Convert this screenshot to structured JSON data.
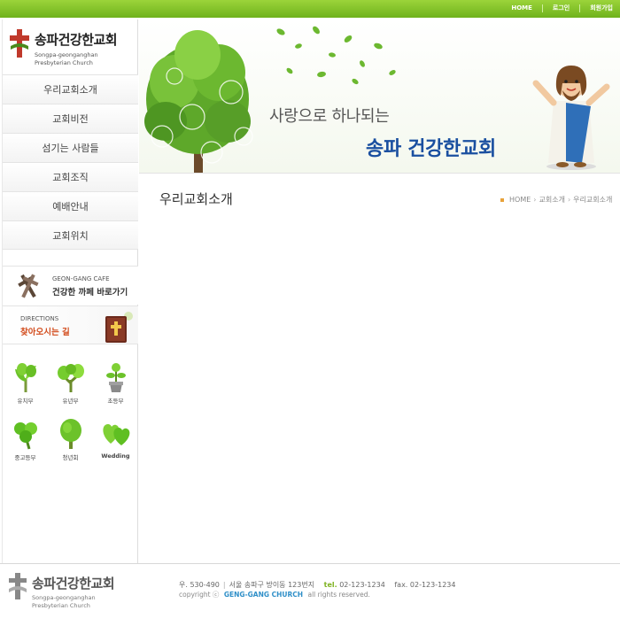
{
  "topnav": {
    "home": "HOME",
    "login": "로그인",
    "join": "회원가입"
  },
  "logo": {
    "name": "송파건강한교회",
    "sub1": "Songpa-geonganghan",
    "sub2": "Presbyterian Church"
  },
  "menu": {
    "items": [
      {
        "label": "우리교회소개"
      },
      {
        "label": "교회비전"
      },
      {
        "label": "섬기는 사람들"
      },
      {
        "label": "교회조직"
      },
      {
        "label": "예배안내"
      },
      {
        "label": "교회위치"
      }
    ]
  },
  "banners": {
    "cafe": {
      "sub": "GEON-GANG CAFE",
      "main": "건강한 까페 바로가기"
    },
    "directions": {
      "sub": "DIRECTIONS",
      "main": "찾아오시는 길"
    }
  },
  "departments": [
    {
      "label": "유치부",
      "icon": "sprout-icon"
    },
    {
      "label": "유년부",
      "icon": "tree-icon"
    },
    {
      "label": "초등부",
      "icon": "potted-plant-icon"
    },
    {
      "label": "중고등부",
      "icon": "clover-icon"
    },
    {
      "label": "청년회",
      "icon": "tree-icon"
    },
    {
      "label": "Wedding",
      "icon": "hearts-icon"
    }
  ],
  "hero": {
    "line1": "사랑으로 하나되는",
    "line2": "송파 건강한교회"
  },
  "page": {
    "title": "우리교회소개",
    "breadcrumb": [
      "HOME",
      "교회소개",
      "우리교회소개"
    ]
  },
  "footer": {
    "logo_name": "송파건강한교회",
    "logo_sub1": "Songpa-geonganghan",
    "logo_sub2": "Presbyterian Church",
    "address": "우. 530-490",
    "address2": "서울 송파구 방이동 123번지",
    "tel_label": "tel.",
    "tel": "02-123-1234",
    "fax_label": "fax.",
    "fax": "02-123-1234",
    "copy_prefix": "copyright ⓒ",
    "church": "GENG-GANG CHURCH",
    "copy_suffix": "all rights reserved."
  },
  "colors": {
    "accent_green": "#7fb322",
    "brand_blue": "#1a4fa0",
    "cross_red": "#c0392b"
  }
}
